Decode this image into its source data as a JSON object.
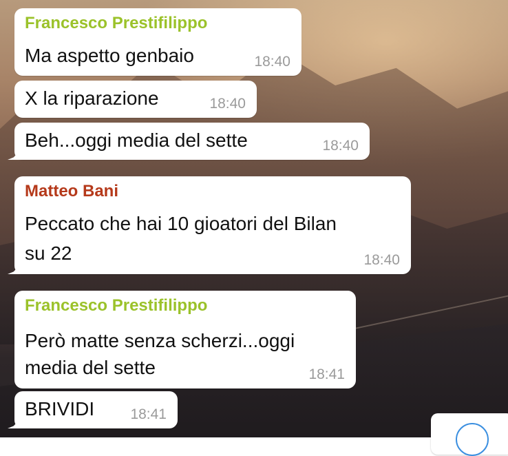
{
  "messages": [
    {
      "sender": "Francesco Prestifilippo",
      "sender_color": "#9bc22a",
      "text": "Ma aspetto genbaio",
      "time": "18:40"
    },
    {
      "text": "X la riparazione",
      "time": "18:40"
    },
    {
      "text": "Beh...oggi media del sette",
      "time": "18:40"
    },
    {
      "sender": "Matteo Bani",
      "sender_color": "#b5391a",
      "lines": [
        "Peccato che hai 10 gioatori del Bilan",
        "su 22"
      ],
      "time": "18:40"
    },
    {
      "sender": "Francesco Prestifilippo",
      "sender_color": "#9bc22a",
      "lines": [
        "Però matte senza scherzi...oggi",
        "media del sette"
      ],
      "time": "18:41"
    },
    {
      "text": "BRIVIDI",
      "time": "18:41"
    }
  ],
  "scroll_button": {
    "icon": "chevron-down-icon",
    "accent_color": "#3b8fe0"
  }
}
